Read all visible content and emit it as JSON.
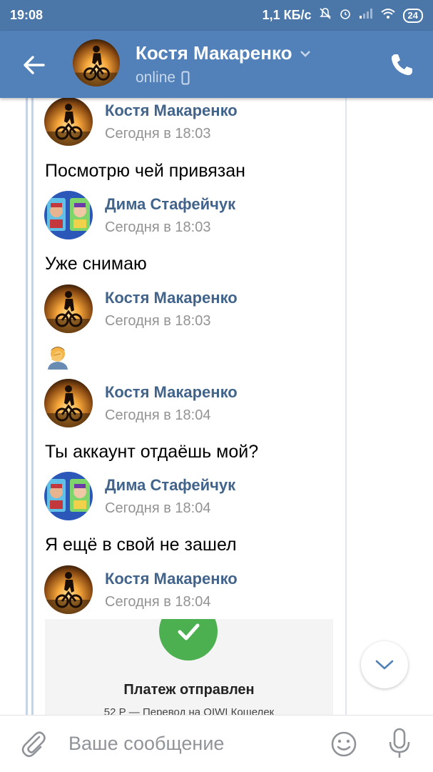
{
  "status_bar": {
    "time": "19:08",
    "speed": "1,1 КБ/с",
    "battery": "24",
    "icons": [
      "mute-icon",
      "alarm-icon",
      "signal-icon",
      "wifi-icon",
      "battery-icon"
    ]
  },
  "header": {
    "name": "Костя Макаренко",
    "status": "online",
    "icons": [
      "back-arrow-icon",
      "chevron-down-icon",
      "mobile-icon",
      "phone-icon"
    ]
  },
  "messages": [
    {
      "author": "Костя Макаренко",
      "time": "Сегодня в 18:03",
      "text": "Посмотрю чей привязан",
      "avatar": "kostya"
    },
    {
      "author": "Дима Стафейчук",
      "time": "Сегодня в 18:03",
      "text": "Уже снимаю",
      "avatar": "dima"
    },
    {
      "author": "Костя Макаренко",
      "time": "Сегодня в 18:03",
      "emoji": "facepalm-emoji",
      "avatar": "kostya"
    },
    {
      "author": "Костя Макаренко",
      "time": "Сегодня в 18:04",
      "text": "Ты аккаунт отдаёшь мой?",
      "avatar": "kostya"
    },
    {
      "author": "Дима Стафейчук",
      "time": "Сегодня в 18:04",
      "text": "Я ещё в свой не зашел",
      "avatar": "dima"
    },
    {
      "author": "Костя Макаренко",
      "time": "Сегодня в 18:04",
      "avatar": "kostya"
    }
  ],
  "payment": {
    "title": "Платеж отправлен",
    "description": "52 Р — Перевод на QIWI Кошелек"
  },
  "composer": {
    "placeholder": "Ваше сообщение",
    "icons": [
      "attach-icon",
      "smile-icon",
      "mic-icon"
    ]
  },
  "colors": {
    "header": "#5181b8",
    "status_bar": "#4a76a8",
    "author": "#42648b",
    "time": "#939393",
    "success": "#4cb050"
  }
}
